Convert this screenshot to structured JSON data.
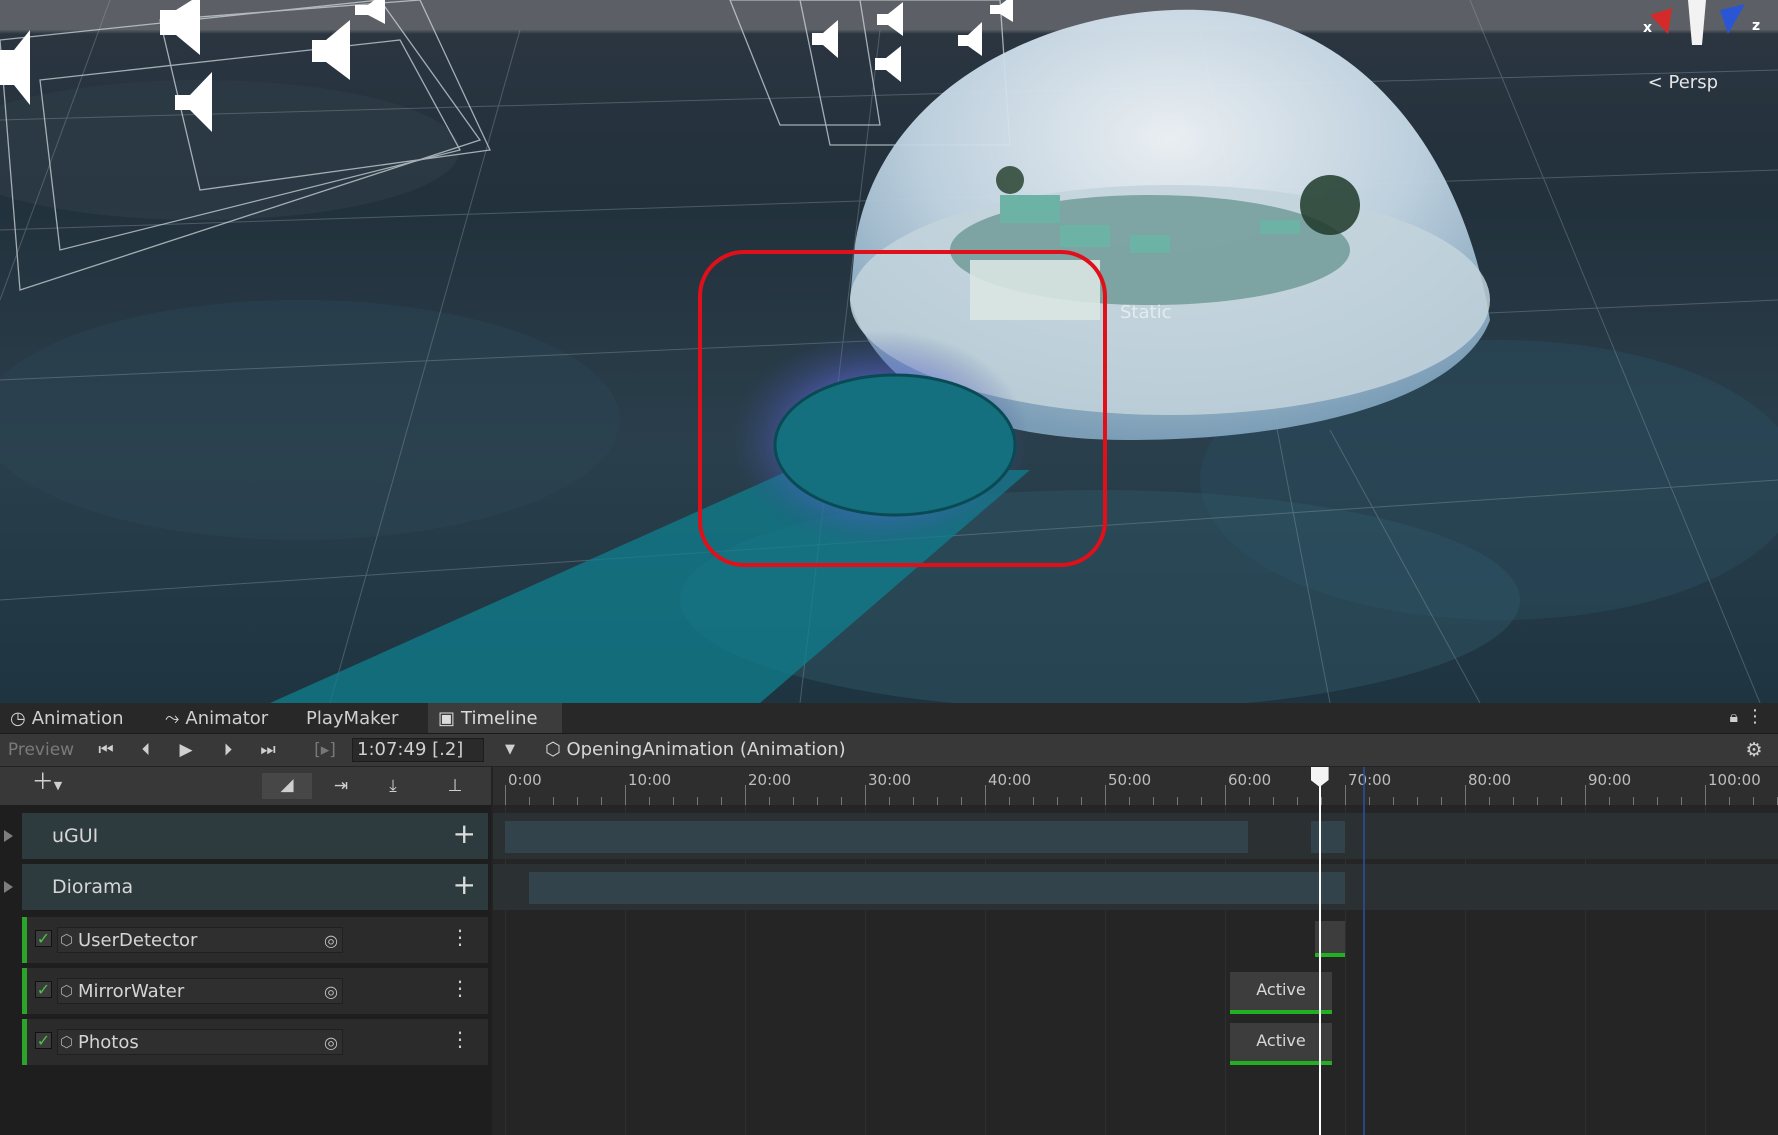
{
  "scene": {
    "view_mode": "Persp",
    "axis_labels": {
      "x": "x",
      "z": "z"
    },
    "static_label": "Static",
    "highlight_color": "#e0101a"
  },
  "tabs": [
    {
      "label": "Animation",
      "icon": "clock-icon",
      "active": false
    },
    {
      "label": "Animator",
      "icon": "animator-icon",
      "active": false
    },
    {
      "label": "PlayMaker",
      "icon": "",
      "active": false
    },
    {
      "label": "Timeline",
      "icon": "film-icon",
      "active": true
    }
  ],
  "toolbar": {
    "preview_label": "Preview",
    "time_value": "1:07:49 [.2]",
    "asset_label": "OpeningAnimation (Animation)",
    "controls": [
      "go-to-start-icon",
      "previous-frame-icon",
      "play-icon",
      "next-frame-icon",
      "go-to-end-icon",
      "range-play-icon"
    ]
  },
  "ruler": {
    "ticks": [
      "0:00",
      "10:00",
      "20:00",
      "30:00",
      "40:00",
      "50:00",
      "60:00",
      "70:00",
      "80:00",
      "90:00",
      "100:00"
    ],
    "playhead_seconds": 67.8
  },
  "tracks": {
    "groups": [
      {
        "label": "uGUI"
      },
      {
        "label": "Diorama"
      }
    ],
    "activation": [
      {
        "name": "UserDetector",
        "enabled": true,
        "clip_label": ""
      },
      {
        "name": "MirrorWater",
        "enabled": true,
        "clip_label": "Active"
      },
      {
        "name": "Photos",
        "enabled": true,
        "clip_label": "Active"
      }
    ]
  },
  "colors": {
    "track_accent": "#2aa52a",
    "group_bg": "#2d3b3e",
    "clip_bar": "#33434c",
    "playhead": "#ffffff"
  }
}
